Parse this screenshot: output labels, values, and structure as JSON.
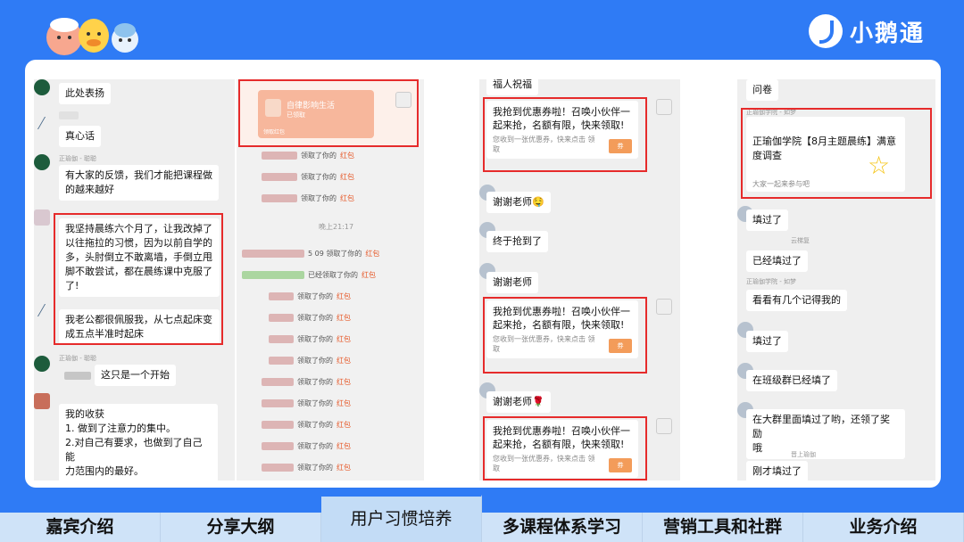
{
  "brand": {
    "logo_text": "小鹅通"
  },
  "shot1": {
    "m1": "此处表扬",
    "m2": "真心话",
    "sender3": "正瑜伽 - 聪聪",
    "m3": "有大家的反馈，我们才能把课程做\n的越来越好",
    "m4": "我坚持晨练六个月了，让我改掉了\n以往拖拉的习惯，因为以前自学的\n多，头肘倒立不敢离墙，手倒立甩\n脚不敢尝试，都在晨练课中克服了\n了!",
    "m5": "我老公都很佩服我，从七点起床变\n成五点半准时起床",
    "sender6": "正瑜伽 - 聪聪",
    "m6": "这只是一个开始",
    "m7": "我的收获\n1. 做到了注意力的集中。\n  2.对自己有要求，也做到了自己能\n力范围内的最好。"
  },
  "shot2": {
    "card_title": "自律影响生活",
    "card_sub": "已领取",
    "card_foot": "领取红包",
    "red_text": "领取了你的",
    "red_word": "红包",
    "time": "晚上21:17",
    "red_text2": "领取了你的",
    "time2": "5 09 领取了你的",
    "red_text3": "已经领取了你的"
  },
  "shot3": {
    "top": "福人祝福",
    "coupon_title": "我抢到优惠券啦！召唤小伙伴一\n起来抢，名额有限，快来领取!",
    "coupon_sub": "您收到一张优惠券，快来点击\n领取",
    "coupon_tag": "券",
    "m2": "谢谢老师🤤",
    "m3": "终于抢到了",
    "m4": "谢谢老师",
    "m5": "谢谢老师🌹"
  },
  "shot4": {
    "m1": "问卷",
    "sender2": "正瑜伽学院 - 如梦",
    "survey_title": "正瑜伽学院【8月主题晨练】满意\n度调查",
    "survey_sub": "大家一起来参与吧",
    "m3": "填过了",
    "sender4": "云梯复",
    "m4": "已经填过了",
    "sender5": "正瑜伽学院 - 如梦",
    "m5": "看看有几个记得我的",
    "m6": "填过了",
    "m7": "在班级群已经填了",
    "m8": "在大群里面填过了哟，还领了奖励\n哦",
    "sender9": "晋上瑜伽",
    "m9": "刚才填过了"
  },
  "tabs": [
    "嘉宾介绍",
    "分享大纲",
    "用户习惯培养",
    "多课程体系学习",
    "营销工具和社群",
    "业务介绍"
  ],
  "active_tab": "用户习惯培养",
  "colors": {
    "brand_blue": "#2f7bf5",
    "highlight_red": "#e62b2b",
    "tab_bg": "#cfe3f8"
  }
}
